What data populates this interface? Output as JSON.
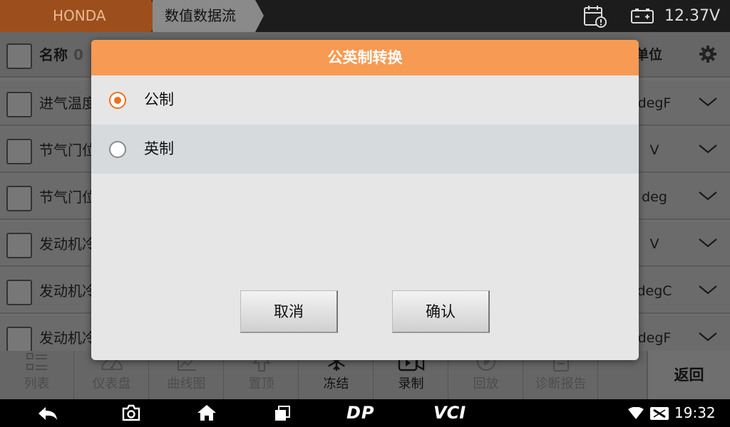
{
  "topbar": {
    "brand": "HONDA",
    "page": "数值数据流",
    "voltage": "12.37V",
    "icons": [
      "calendar-alert-icon",
      "battery-icon"
    ]
  },
  "table": {
    "header": {
      "name": "名称",
      "name_suffix": "0",
      "unit": "单位"
    },
    "rows": [
      {
        "name": "进气温度",
        "unit": "degF"
      },
      {
        "name": "节气门位",
        "unit": "V"
      },
      {
        "name": "节气门位",
        "unit": "deg"
      },
      {
        "name": "发动机冷",
        "unit": "V"
      },
      {
        "name": "发动机冷",
        "unit": "degC"
      },
      {
        "name": "发动机冷",
        "unit": "degF"
      }
    ]
  },
  "toolbar": {
    "items": [
      {
        "label": "列表",
        "icon": "list-icon"
      },
      {
        "label": "仪表盘",
        "icon": "gauge-icon"
      },
      {
        "label": "曲线图",
        "icon": "line-chart-icon"
      },
      {
        "label": "置顶",
        "icon": "pin-top-icon"
      },
      {
        "label": "冻结",
        "icon": "snowflake-icon"
      },
      {
        "label": "录制",
        "icon": "video-record-icon"
      },
      {
        "label": "回放",
        "icon": "playback-icon"
      },
      {
        "label": "诊断报告",
        "icon": "report-icon"
      }
    ],
    "back": "返回"
  },
  "navbar": {
    "dp": "DP",
    "vci": "VCI",
    "time": "19:32"
  },
  "dialog": {
    "title": "公英制转换",
    "options": [
      {
        "label": "公制",
        "selected": true
      },
      {
        "label": "英制",
        "selected": false
      }
    ],
    "cancel": "取消",
    "confirm": "确认"
  },
  "colors": {
    "accent": "#f79a53",
    "radio_selected": "#ee6f1f",
    "brand_tab": "#9c4f1c"
  }
}
